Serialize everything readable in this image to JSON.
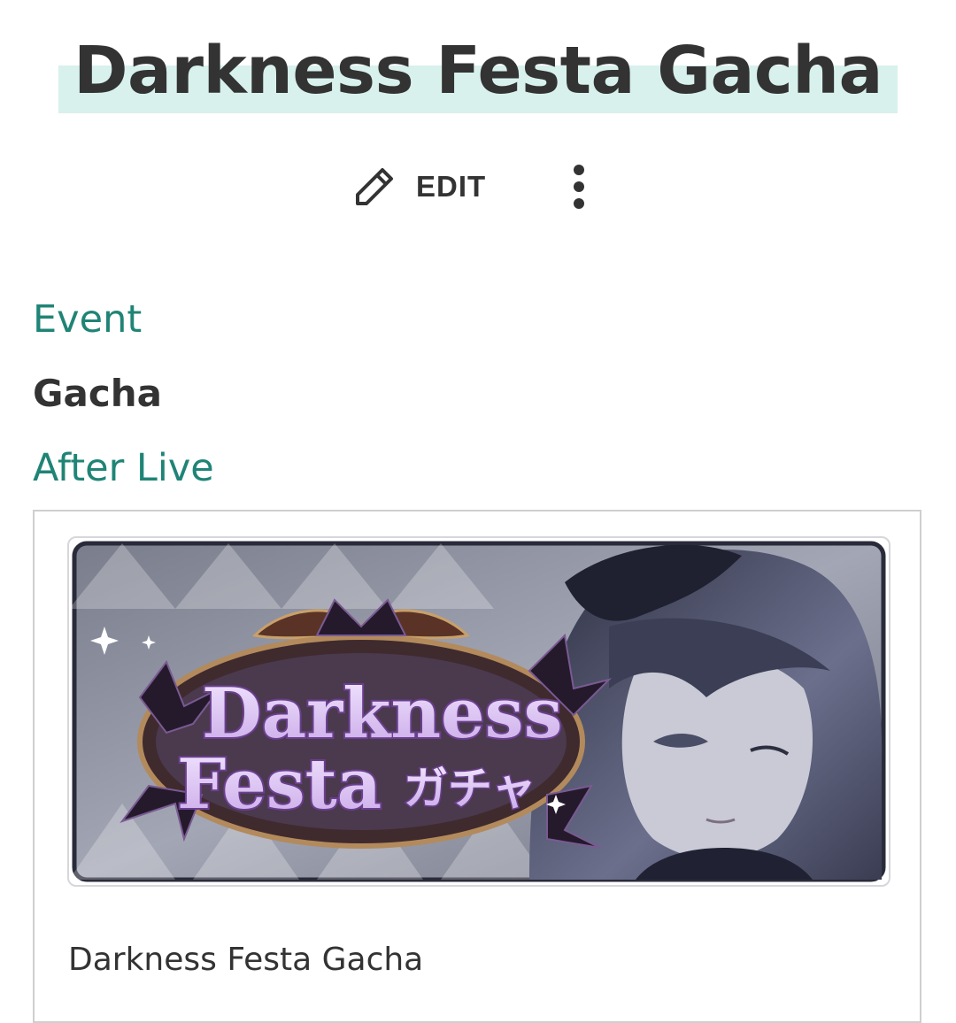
{
  "page": {
    "title": "Darkness Festa Gacha"
  },
  "actions": {
    "edit_label": "EDIT",
    "edit_icon": "pencil-icon",
    "more_icon": "more-vertical-icon"
  },
  "breadcrumbs": {
    "previous": "Event",
    "current": "Gacha",
    "next": "After Live"
  },
  "infobox": {
    "image_logo_text_line1": "Darkness",
    "image_logo_text_line2": "Festa",
    "image_logo_text_jp": "ガチャ",
    "caption": "Darkness Festa Gacha"
  },
  "colors": {
    "link": "#1f8476",
    "title_highlight": "#d8f1ec",
    "text": "#333333",
    "logo_purple": "#6b3f8f"
  }
}
